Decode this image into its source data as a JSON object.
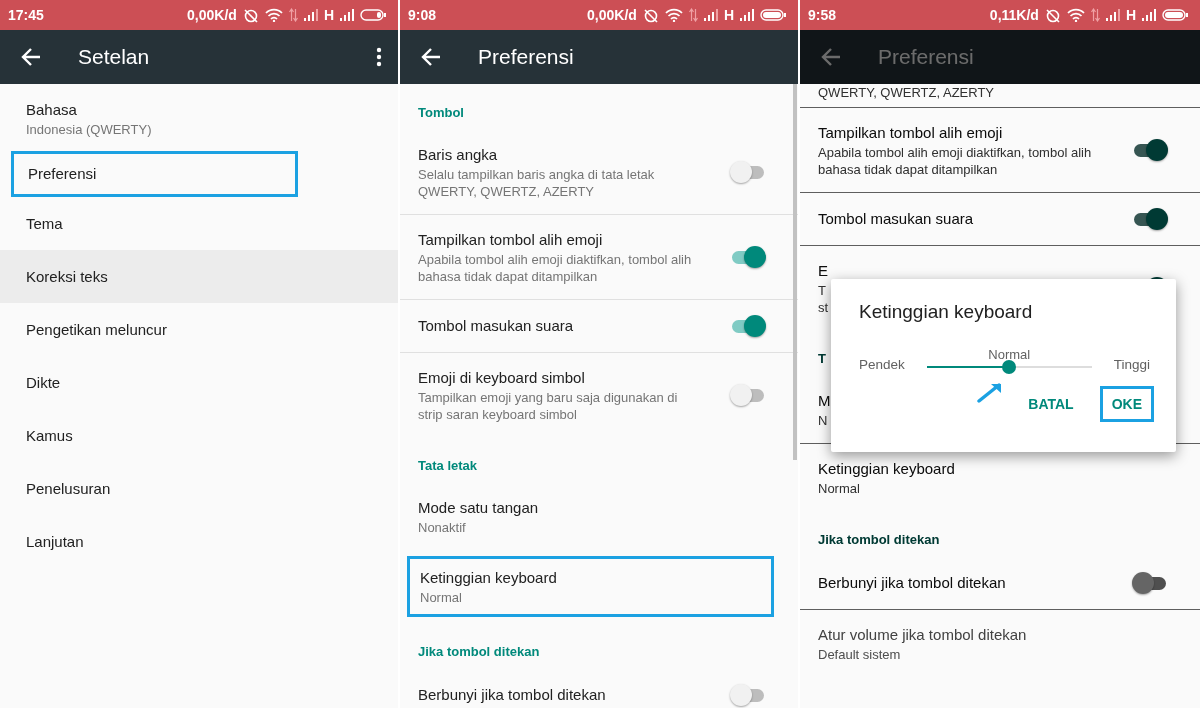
{
  "screens": [
    {
      "status_bar": {
        "time": "17:45",
        "data_rate": "0,00K/d",
        "network": "H",
        "battery_low": true
      },
      "app_bar": {
        "title": "Setelan",
        "menu": true
      },
      "dimmed": false,
      "list": [
        {
          "kind": "item",
          "title": "Bahasa",
          "subtitle": [
            "Indonesia (QWERTY)"
          ],
          "highlighted": false,
          "pressed": false
        },
        {
          "kind": "item",
          "title": "Preferensi",
          "highlighted": true,
          "pressed": false
        },
        {
          "kind": "item",
          "title": "Tema",
          "highlighted": false,
          "pressed": false
        },
        {
          "kind": "item",
          "title": "Koreksi teks",
          "highlighted": false,
          "pressed": true
        },
        {
          "kind": "item",
          "title": "Pengetikan meluncur",
          "highlighted": false,
          "pressed": false
        },
        {
          "kind": "item",
          "title": "Dikte",
          "highlighted": false,
          "pressed": false
        },
        {
          "kind": "item",
          "title": "Kamus",
          "highlighted": false,
          "pressed": false
        },
        {
          "kind": "item",
          "title": "Penelusuran",
          "highlighted": false,
          "pressed": false
        },
        {
          "kind": "item",
          "title": "Lanjutan",
          "highlighted": false,
          "pressed": false
        }
      ]
    },
    {
      "status_bar": {
        "time": "9:08",
        "data_rate": "0,00K/d",
        "network": "H",
        "battery_low": false
      },
      "app_bar": {
        "title": "Preferensi"
      },
      "dimmed": false,
      "scrollbar": true,
      "list": [
        {
          "kind": "section",
          "title": "Tombol"
        },
        {
          "kind": "toggle",
          "title": "Baris angka",
          "subtitle": [
            "Selalu tampilkan baris angka di tata letak",
            "QWERTY, QWERTZ, AZERTY"
          ],
          "on": false,
          "highlighted": false
        },
        {
          "kind": "toggle",
          "title": "Tampilkan tombol alih emoji",
          "subtitle": [
            "Apabila tombol alih emoji diaktifkan, tombol alih",
            "bahasa tidak dapat ditampilkan"
          ],
          "on": true,
          "highlighted": false
        },
        {
          "kind": "toggle",
          "title": "Tombol masukan suara",
          "on": true,
          "highlighted": false
        },
        {
          "kind": "toggle",
          "title": "Emoji di keyboard simbol",
          "subtitle": [
            "Tampilkan emoji yang baru saja digunakan di",
            "strip saran keyboard simbol"
          ],
          "on": false,
          "highlighted": false
        },
        {
          "kind": "section",
          "title": "Tata letak"
        },
        {
          "kind": "item",
          "title": "Mode satu tangan",
          "subtitle": [
            "Nonaktif"
          ],
          "highlighted": false
        },
        {
          "kind": "item",
          "title": "Ketinggian keyboard",
          "subtitle": [
            "Normal"
          ],
          "highlighted": true
        },
        {
          "kind": "section",
          "title": "Jika tombol ditekan"
        },
        {
          "kind": "toggle",
          "title": "Berbunyi jika tombol ditekan",
          "on": false,
          "highlighted": false
        }
      ]
    },
    {
      "status_bar": {
        "time": "9:58",
        "data_rate": "0,11K/d",
        "network": "H",
        "battery_low": false
      },
      "app_bar": {
        "title": "Preferensi"
      },
      "dimmed": true,
      "list": [
        {
          "kind": "item",
          "subtitle": [
            "QWERTY, QWERTZ, AZERTY"
          ],
          "disabled": false
        },
        {
          "kind": "toggle",
          "title": "Tampilkan tombol alih emoji",
          "subtitle": [
            "Apabila tombol alih emoji diaktifkan, tombol alih",
            "bahasa tidak dapat ditampilkan"
          ],
          "on": true,
          "disabled": false
        },
        {
          "kind": "toggle",
          "title": "Tombol masukan suara",
          "on": true,
          "disabled": false
        },
        {
          "kind": "toggle",
          "title": "E",
          "subtitle": [
            "T",
            "st"
          ],
          "on": true,
          "disabled": false
        },
        {
          "kind": "section",
          "title": "T"
        },
        {
          "kind": "item",
          "title": "M",
          "subtitle": [
            "N"
          ],
          "disabled": false
        },
        {
          "kind": "item",
          "title": "Ketinggian keyboard",
          "subtitle": [
            "Normal"
          ],
          "disabled": false
        },
        {
          "kind": "section",
          "title": "Jika tombol ditekan"
        },
        {
          "kind": "toggle",
          "title": "Berbunyi jika tombol ditekan",
          "on": false,
          "disabled": false
        },
        {
          "kind": "item",
          "title": "Atur volume jika tombol ditekan",
          "subtitle": [
            "Default sistem"
          ],
          "disabled": true
        }
      ],
      "dialog": {
        "title": "Ketinggian keyboard",
        "value_label": "Normal",
        "min_label": "Pendek",
        "max_label": "Tinggi",
        "level": 0.5,
        "pointer": true,
        "buttons": [
          {
            "label": "BATAL",
            "highlighted": false
          },
          {
            "label": "OKE",
            "highlighted": true
          }
        ]
      }
    }
  ]
}
